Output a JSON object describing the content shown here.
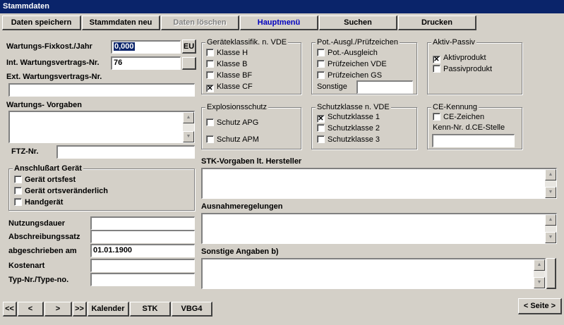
{
  "window": {
    "title": "Stammdaten"
  },
  "toolbar": {
    "save": "Daten speichern",
    "new": "Stammdaten neu",
    "delete": "Daten löschen",
    "main_menu": "Hauptmenü",
    "search": "Suchen",
    "print": "Drucken"
  },
  "fields": {
    "wartung_fix_label": "Wartungs-Fixkost./Jahr",
    "wartung_fix_value": "0,000",
    "currency_btn": "EU",
    "int_vertrag_label": "Int. Wartungsvertrags-Nr.",
    "int_vertrag_value": "76",
    "ext_vertrag_label": "Ext. Wartungsvertrags-Nr.",
    "ext_vertrag_value": "",
    "vorgaben_label": "Wartungs- Vorgaben",
    "ftz_label": "FTZ-Nr.",
    "ftz_value": "",
    "nutzung_label": "Nutzungsdauer",
    "abschreib_label": "Abschreibungssatz",
    "abgeschrieben_label": "abgeschrieben am",
    "abgeschrieben_value": "01.01.1900",
    "kostenart_label": "Kostenart",
    "typnr_label": "Typ-Nr./Type-no."
  },
  "anschluss": {
    "title": "Anschlußart Gerät",
    "items": [
      "Gerät ortsfest",
      "Gerät ortsveränderlich",
      "Handgerät"
    ]
  },
  "geraeteklasse": {
    "title": "Geräteklassifik. n. VDE",
    "items": [
      "Klasse H",
      "Klasse B",
      "Klasse BF",
      "Klasse CF"
    ],
    "checked": [
      false,
      false,
      false,
      true
    ]
  },
  "potausgl": {
    "title": "Pot.-Ausgl./Prüfzeichen",
    "items": [
      "Pot.-Ausgleich",
      "Prüfzeichen VDE",
      "Prüfzeichen GS"
    ],
    "sonstige_label": "Sonstige"
  },
  "aktivpassiv": {
    "title": "Aktiv-Passiv",
    "items": [
      "Aktivprodukt",
      "Passivprodukt"
    ],
    "checked": [
      true,
      false
    ]
  },
  "explosion": {
    "title": "Explosionsschutz",
    "items": [
      "Schutz APG",
      "Schutz APM"
    ]
  },
  "schutzklasse": {
    "title": "Schutzklasse n. VDE",
    "items": [
      "Schutzklasse 1",
      "Schutzklasse 2",
      "Schutzklasse 3"
    ],
    "checked": [
      true,
      false,
      false
    ]
  },
  "ce": {
    "title": "CE-Kennung",
    "checkbox": "CE-Zeichen",
    "kenn_label": "Kenn-Nr. d.CE-Stelle"
  },
  "memos": {
    "stk_label": "STK-Vorgaben lt. Hersteller",
    "ausnahme_label": "Ausnahmeregelungen",
    "sonstige_label": "Sonstige Angaben b)"
  },
  "nav": {
    "first": "<<",
    "prev": "<",
    "next": ">",
    "last": ">>",
    "kalender": "Kalender",
    "stk": "STK",
    "vbg4": "VBG4",
    "seite": "< Seite >"
  }
}
